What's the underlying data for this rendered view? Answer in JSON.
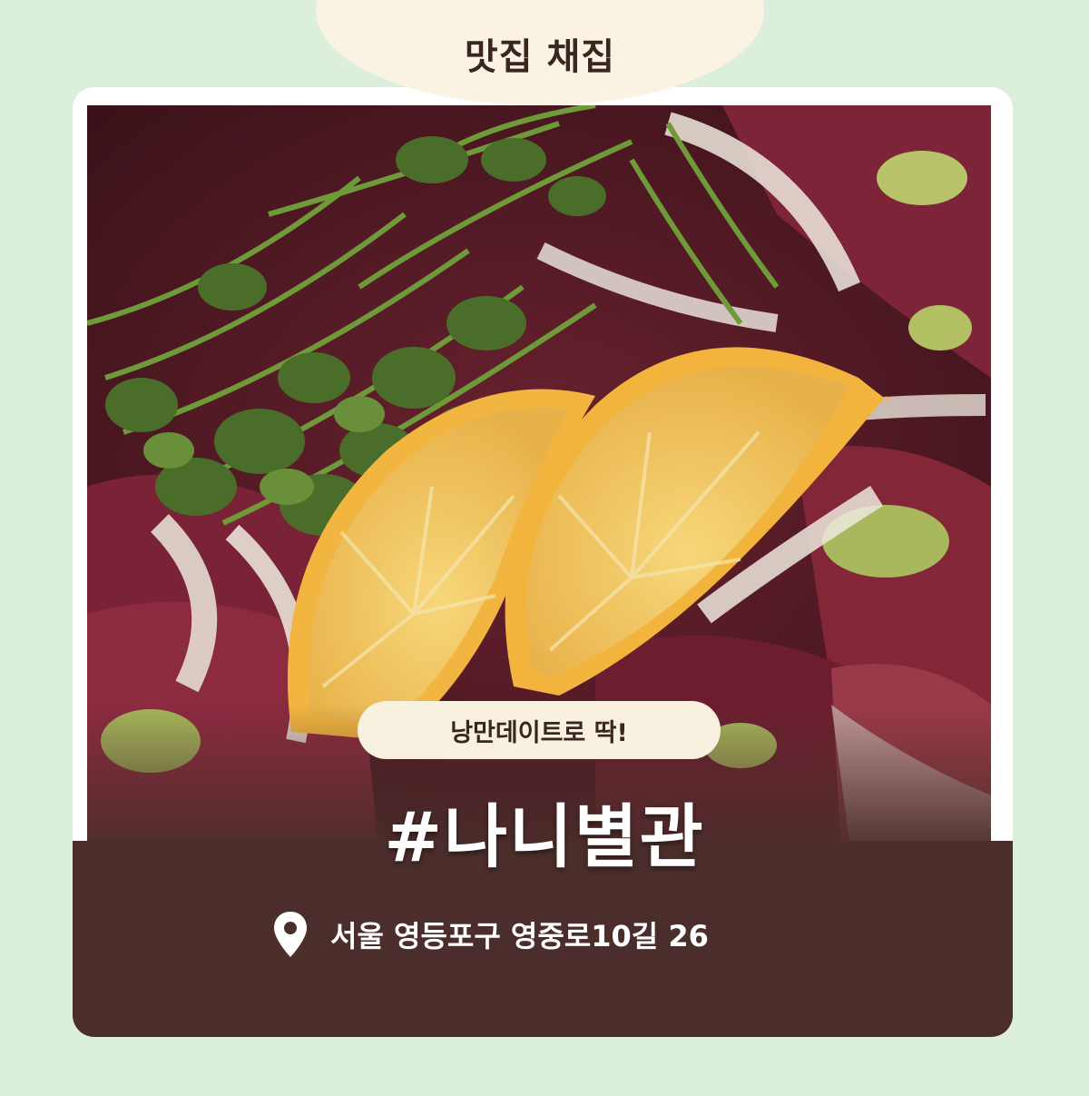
{
  "header": {
    "title": "맛집 채집"
  },
  "card": {
    "tagline": "낭만데이트로 딱!",
    "name": "#나니별관",
    "address": "서울 영등포구 영중로10길 26",
    "location_icon": "map-pin-icon"
  },
  "colors": {
    "background": "#dcefdd",
    "bubble": "#faf3e3",
    "panel": "#4b2e2b",
    "text_dark": "#3a2620",
    "text_light": "#ffffff"
  }
}
